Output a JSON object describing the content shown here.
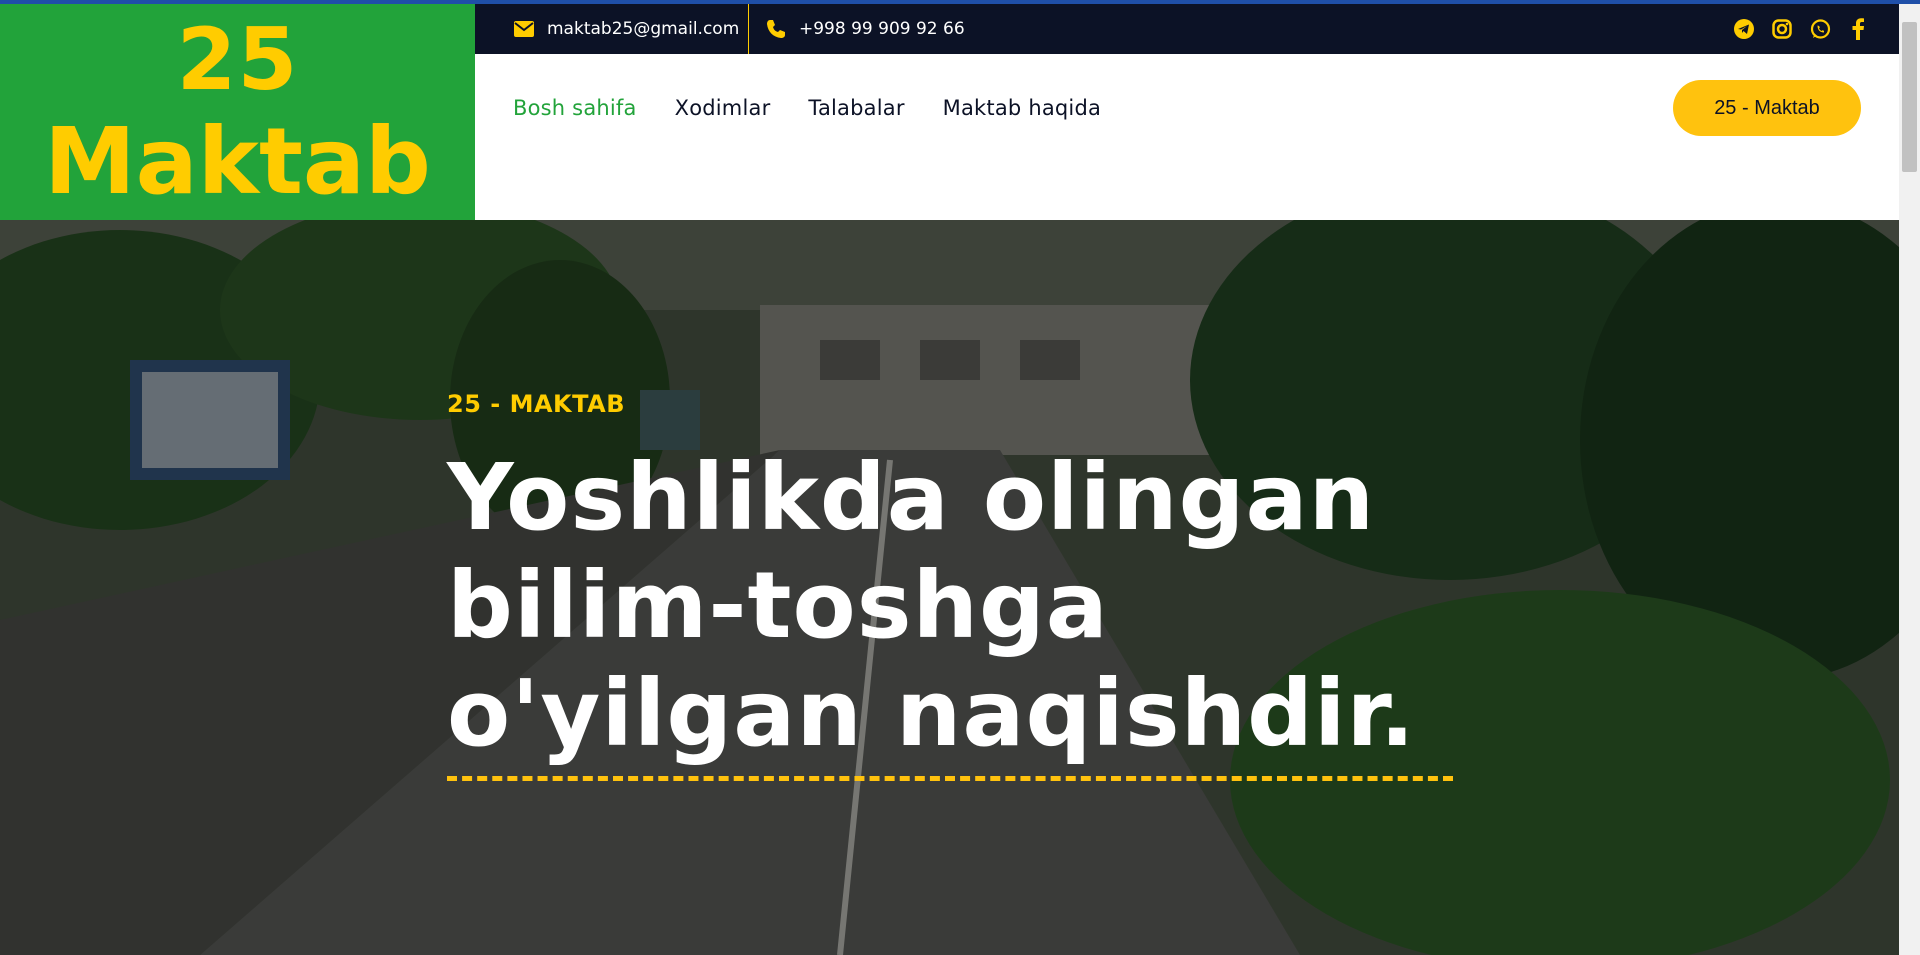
{
  "logo": {
    "line1": "25",
    "line2": "Maktab"
  },
  "topbar": {
    "email": "maktab25@gmail.com",
    "phone": "+998 99 909 92 66",
    "social": [
      "telegram-icon",
      "instagram-icon",
      "whatsapp-icon",
      "facebook-icon"
    ]
  },
  "nav": {
    "items": [
      {
        "label": "Bosh sahifa",
        "active": true
      },
      {
        "label": "Xodimlar"
      },
      {
        "label": "Talabalar"
      },
      {
        "label": "Maktab haqida"
      }
    ],
    "cta": "25 - Maktab"
  },
  "hero": {
    "kicker": "25 - MAKTAB",
    "title_lines": [
      "Yoshlikda olingan",
      "bilim-toshga",
      "o'yilgan naqishdir."
    ]
  },
  "colors": {
    "brand_green": "#22a33a",
    "brand_yellow": "#ffcc00",
    "button_yellow": "#ffc20e",
    "navy": "#0c1226"
  }
}
